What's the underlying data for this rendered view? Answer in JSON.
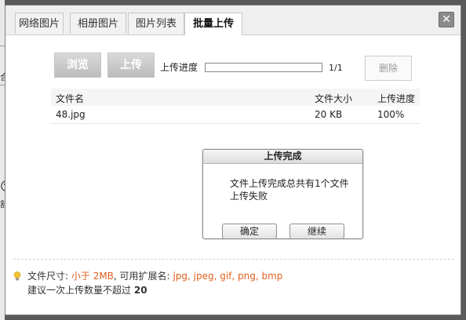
{
  "background": {
    "frag1": "合",
    "frag2": "😮",
    "frag3": "舒"
  },
  "tabs": [
    {
      "label": "网络图片",
      "active": false
    },
    {
      "label": "相册图片",
      "active": false
    },
    {
      "label": "图片列表",
      "active": false
    },
    {
      "label": "批量上传",
      "active": true
    }
  ],
  "close_label": "✕",
  "toolbar": {
    "browse_label": "浏览",
    "upload_label": "上传",
    "progress_label": "上传进度",
    "progress_count": "1/1",
    "progress_fraction": 0,
    "delete_label": "删除"
  },
  "table": {
    "headers": [
      "文件名",
      "文件大小",
      "上传进度"
    ],
    "rows": [
      [
        "48.jpg",
        "20 KB",
        "100%"
      ]
    ]
  },
  "modal": {
    "title": "上传完成",
    "message": "文件上传完成总共有1个文件上传失败",
    "ok_label": "确定",
    "continue_label": "继续"
  },
  "info": {
    "size_prefix": "文件尺寸:",
    "size_value": "小于 2MB",
    "ext_prefix": ", 可用扩展名:",
    "ext_value": "jpg, jpeg, gif, png, bmp",
    "limit_text": "建议一次上传数量不超过",
    "limit_value": "20"
  },
  "colors": {
    "highlight": "#e06020",
    "bulb": "#f2c230"
  }
}
